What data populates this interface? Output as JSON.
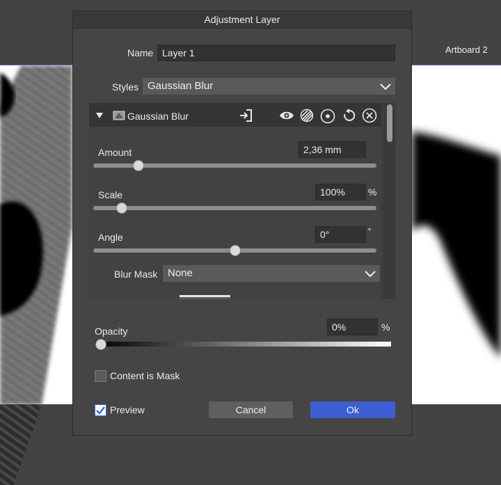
{
  "canvas": {
    "artboard_label": "Artboard 2"
  },
  "dialog": {
    "title": "Adjustment Layer",
    "name_label": "Name",
    "name_value": "Layer 1",
    "styles_label": "Styles",
    "styles_value": "Gaussian Blur",
    "effect": {
      "title": "Gaussian Blur",
      "icons": [
        "collapse-triangle-icon",
        "blur-effect-icon",
        "import-icon",
        "eye-icon",
        "blend-mode-icon",
        "target-icon",
        "reset-icon",
        "close-icon"
      ],
      "amount": {
        "label": "Amount",
        "value": "2,36 mm",
        "level": 0.16
      },
      "scale": {
        "label": "Scale",
        "value": "100%",
        "unit": "%",
        "level": 0.1
      },
      "angle": {
        "label": "Angle",
        "value": "0°",
        "unit": "˚",
        "level": 0.5
      },
      "blur_mask": {
        "label": "Blur Mask",
        "value": "None"
      }
    },
    "opacity": {
      "label": "Opacity",
      "value": "0%",
      "unit": "%",
      "level": 0.0
    },
    "content_is_mask": {
      "label": "Content is Mask",
      "checked": false
    },
    "preview": {
      "label": "Preview",
      "checked": true
    },
    "buttons": {
      "cancel": "Cancel",
      "ok": "Ok"
    }
  },
  "colors": {
    "background": "#434343",
    "dialog": "#454545",
    "accent": "#3d5fd3",
    "field": "#323232"
  }
}
